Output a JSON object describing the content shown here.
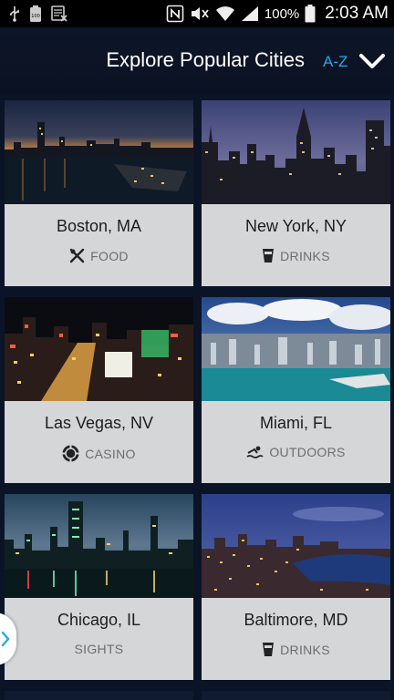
{
  "status_bar": {
    "left_icons": [
      "usb-icon",
      "battery-100-icon",
      "calendar-off-icon"
    ],
    "battery_small_label": "100",
    "right_icons": [
      "nfc-icon",
      "mute-icon",
      "wifi-icon",
      "signal-icon",
      "battery-icon"
    ],
    "battery_percent": "100%",
    "time": "2:03 AM"
  },
  "header": {
    "title": "Explore Popular Cities",
    "sort_label": "A-Z",
    "sort_icon": "chevron-down-icon"
  },
  "cities": [
    {
      "name": "Boston, MA",
      "category": "FOOD",
      "icon": "fork-knife-icon"
    },
    {
      "name": "New York, NY",
      "category": "DRINKS",
      "icon": "pint-glass-icon"
    },
    {
      "name": "Las Vegas, NV",
      "category": "CASINO",
      "icon": "poker-chip-icon"
    },
    {
      "name": "Miami, FL",
      "category": "OUTDOORS",
      "icon": "swimmer-icon"
    },
    {
      "name": "Chicago, IL",
      "category": "SIGHTS",
      "icon": ""
    },
    {
      "name": "Baltimore, MD",
      "category": "DRINKS",
      "icon": "pint-glass-icon"
    }
  ],
  "colors": {
    "background": "#0b1426",
    "accent": "#27a8e8",
    "card": "#d5d6d8"
  }
}
